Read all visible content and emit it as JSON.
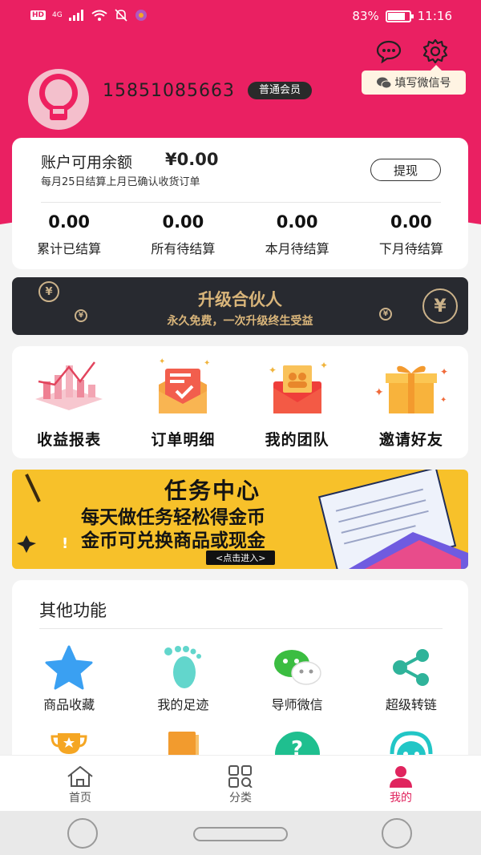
{
  "status_bar": {
    "signal": "4G",
    "hd": "HD",
    "battery": "83%",
    "battery_level": 0.83,
    "time": "11:16"
  },
  "header": {
    "wechat_tip": "填写微信号",
    "message_icon": "message-icon",
    "settings_icon": "gear-icon"
  },
  "profile": {
    "phone": "15851085663",
    "member_level": "普通会员"
  },
  "balance": {
    "label": "账户可用余额",
    "amount": "¥0.00",
    "sub": "每月25日结算上月已确认收货订单",
    "withdraw": "提现",
    "stats": [
      {
        "value": "0.00",
        "label": "累计已结算"
      },
      {
        "value": "0.00",
        "label": "所有待结算"
      },
      {
        "value": "0.00",
        "label": "本月待结算"
      },
      {
        "value": "0.00",
        "label": "下月待结算"
      }
    ]
  },
  "partner_banner": {
    "title": "升级合伙人",
    "subtitle": "永久免费，一次升级终生受益",
    "coin_symbol": "¥"
  },
  "shortcuts": [
    {
      "label": "收益报表",
      "icon": "chart-icon"
    },
    {
      "label": "订单明细",
      "icon": "order-icon"
    },
    {
      "label": "我的团队",
      "icon": "team-icon"
    },
    {
      "label": "邀请好友",
      "icon": "gift-icon"
    }
  ],
  "task_banner": {
    "title": "任务中心",
    "line1": "每天做任务轻松得金币",
    "line2": "金币可兑换商品或现金",
    "enter": "<点击进入>"
  },
  "other": {
    "title": "其他功能",
    "items": [
      {
        "label": "商品收藏",
        "icon": "star-icon"
      },
      {
        "label": "我的足迹",
        "icon": "footprint-icon"
      },
      {
        "label": "导师微信",
        "icon": "wechat-icon"
      },
      {
        "label": "超级转链",
        "icon": "share-icon"
      }
    ],
    "row2_icons": [
      "trophy-icon",
      "notebook-icon",
      "help-icon",
      "support-icon"
    ]
  },
  "tabbar": [
    {
      "label": "首页",
      "icon": "home-icon",
      "active": false
    },
    {
      "label": "分类",
      "icon": "category-icon",
      "active": false
    },
    {
      "label": "我的",
      "icon": "user-icon",
      "active": true
    }
  ],
  "colors": {
    "brand": "#ea2062",
    "gold": "#d9b57a",
    "banner_yellow": "#f7c12a"
  }
}
